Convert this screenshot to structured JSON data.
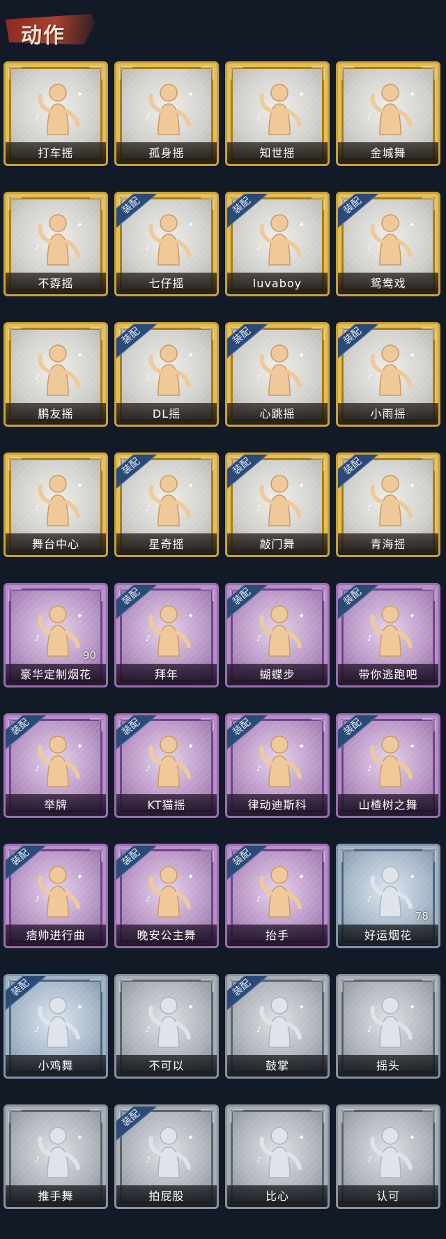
{
  "header": {
    "title": "动作"
  },
  "colors": {
    "gold": "#c9a237",
    "purple": "#9a6eb0",
    "silver": "#8b929c",
    "blue": "#7f95ab",
    "figure": "#f0c99a"
  },
  "items": [
    {
      "label": "打车摇",
      "tier": "gold",
      "equipped": "",
      "count": "",
      "icon": "dance-figure-icon"
    },
    {
      "label": "孤身摇",
      "tier": "gold",
      "equipped": "",
      "count": "",
      "icon": "dance-figure-icon"
    },
    {
      "label": "知世摇",
      "tier": "gold",
      "equipped": "",
      "count": "",
      "icon": "dance-figure-icon"
    },
    {
      "label": "金城舞",
      "tier": "gold",
      "equipped": "",
      "count": "",
      "icon": "dance-figure-icon"
    },
    {
      "label": "不孬摇",
      "tier": "gold",
      "equipped": "",
      "count": "",
      "icon": "dance-figure-icon"
    },
    {
      "label": "七仔摇",
      "tier": "gold",
      "equipped": "装配",
      "count": "",
      "icon": "dance-figure-icon"
    },
    {
      "label": "luvaboy",
      "tier": "gold",
      "equipped": "装配",
      "count": "",
      "icon": "dance-figure-icon"
    },
    {
      "label": "鸳鸯戏",
      "tier": "gold",
      "equipped": "装配",
      "count": "",
      "icon": "dance-figure-icon"
    },
    {
      "label": "鹏友摇",
      "tier": "gold",
      "equipped": "",
      "count": "",
      "icon": "dance-figure-icon"
    },
    {
      "label": "DL摇",
      "tier": "gold",
      "equipped": "装配",
      "count": "",
      "icon": "dance-figure-icon"
    },
    {
      "label": "心跳摇",
      "tier": "gold",
      "equipped": "装配",
      "count": "",
      "icon": "dance-figure-icon"
    },
    {
      "label": "小雨摇",
      "tier": "gold",
      "equipped": "装配",
      "count": "",
      "icon": "dance-figure-icon"
    },
    {
      "label": "舞台中心",
      "tier": "gold",
      "equipped": "",
      "count": "",
      "icon": "dance-figure-icon"
    },
    {
      "label": "星奇摇",
      "tier": "gold",
      "equipped": "装配",
      "count": "",
      "icon": "dance-figure-icon"
    },
    {
      "label": "敲门舞",
      "tier": "gold",
      "equipped": "装配",
      "count": "",
      "icon": "dance-figure-icon"
    },
    {
      "label": "青海摇",
      "tier": "gold",
      "equipped": "装配",
      "count": "",
      "icon": "dance-figure-icon"
    },
    {
      "label": "豪华定制烟花",
      "tier": "purple",
      "equipped": "",
      "count": "90",
      "icon": "firework-box-icon"
    },
    {
      "label": "拜年",
      "tier": "purple",
      "equipped": "装配",
      "count": "",
      "icon": "bow-figure-icon"
    },
    {
      "label": "蝴蝶步",
      "tier": "purple",
      "equipped": "装配",
      "count": "",
      "icon": "dance-figure-icon"
    },
    {
      "label": "带你逃跑吧",
      "tier": "purple",
      "equipped": "装配",
      "count": "",
      "icon": "dance-figure-icon"
    },
    {
      "label": "举牌",
      "tier": "purple",
      "equipped": "装配",
      "count": "",
      "icon": "sign-board-icon"
    },
    {
      "label": "KT猫摇",
      "tier": "purple",
      "equipped": "装配",
      "count": "",
      "icon": "dance-figure-icon"
    },
    {
      "label": "律动迪斯科",
      "tier": "purple",
      "equipped": "装配",
      "count": "",
      "icon": "dance-figure-icon"
    },
    {
      "label": "山楂树之舞",
      "tier": "purple",
      "equipped": "装配",
      "count": "",
      "icon": "dance-figure-icon"
    },
    {
      "label": "痞帅进行曲",
      "tier": "purple",
      "equipped": "装配",
      "count": "",
      "icon": "dance-figure-icon"
    },
    {
      "label": "晚安公主舞",
      "tier": "purple",
      "equipped": "装配",
      "count": "",
      "icon": "dance-figure-icon"
    },
    {
      "label": "抬手",
      "tier": "purple",
      "equipped": "装配",
      "count": "",
      "icon": "raise-hand-icon"
    },
    {
      "label": "好运烟花",
      "tier": "blue",
      "equipped": "",
      "count": "78",
      "icon": "firework-can-icon"
    },
    {
      "label": "小鸡舞",
      "tier": "blue",
      "equipped": "装配",
      "count": "",
      "icon": "dance-figure-icon"
    },
    {
      "label": "不可以",
      "tier": "silver",
      "equipped": "",
      "count": "",
      "icon": "finger-wag-icon"
    },
    {
      "label": "鼓掌",
      "tier": "silver",
      "equipped": "装配",
      "count": "",
      "icon": "clap-hands-icon"
    },
    {
      "label": "摇头",
      "tier": "silver",
      "equipped": "",
      "count": "",
      "icon": "dance-figure-icon"
    },
    {
      "label": "推手舞",
      "tier": "silver",
      "equipped": "",
      "count": "",
      "icon": "dance-figure-icon"
    },
    {
      "label": "拍屁股",
      "tier": "silver",
      "equipped": "装配",
      "count": "",
      "icon": "dance-figure-icon"
    },
    {
      "label": "比心",
      "tier": "silver",
      "equipped": "",
      "count": "",
      "icon": "heart-hands-icon"
    },
    {
      "label": "认可",
      "tier": "silver",
      "equipped": "",
      "count": "",
      "icon": "thumbs-up-icon"
    }
  ]
}
